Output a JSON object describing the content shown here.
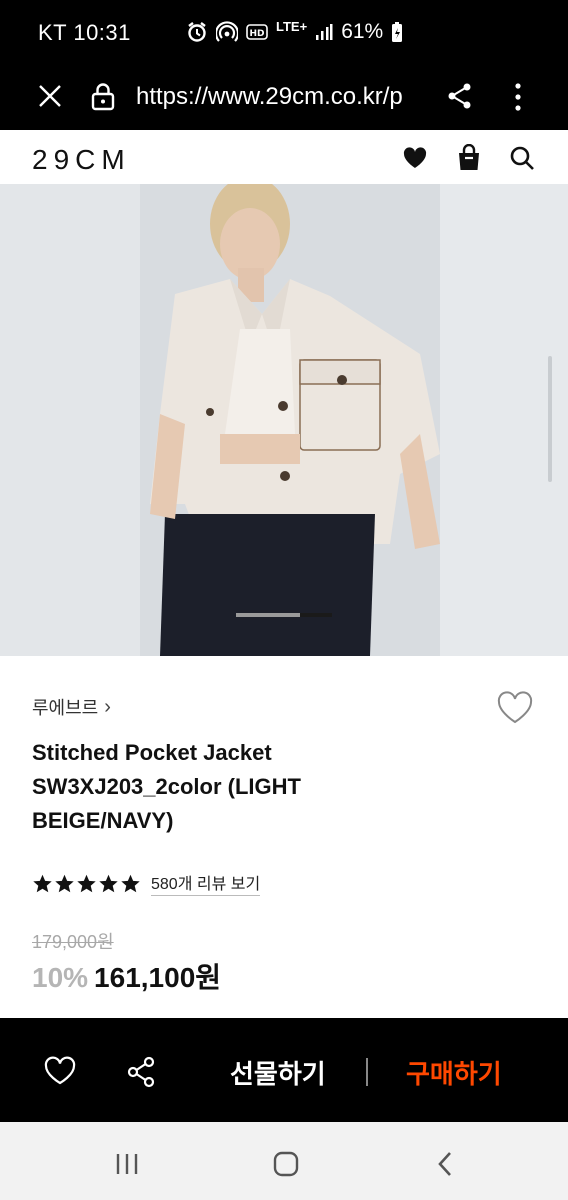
{
  "status_bar": {
    "carrier_time": "KT 10:31",
    "network": "LTE+",
    "battery": "61%",
    "icons": [
      "alarm-icon",
      "hotspot-icon",
      "hd-icon",
      "lte-icon",
      "signal-icon",
      "battery-icon"
    ]
  },
  "browser": {
    "url": "https://www.29cm.co.kr/p",
    "icons": [
      "close-icon",
      "lock-icon",
      "share-icon",
      "more-vertical-icon"
    ]
  },
  "site_header": {
    "logo": "29CM",
    "icons": [
      "heart-icon",
      "shopping-bag-icon",
      "search-icon"
    ]
  },
  "product": {
    "brand": "루에브르",
    "brand_arrow": "›",
    "title": "Stitched Pocket Jacket SW3XJ203_2color (LIGHT BEIGE/NAVY)",
    "rating_stars": 5,
    "review_link": "580개 리뷰 보기",
    "original_price": "179,000원",
    "discount": "10%",
    "sale_price": "161,100원"
  },
  "carousel": {
    "active_fraction": 0.67
  },
  "buy_bar": {
    "gift_label": "선물하기",
    "buy_label": "구매하기",
    "icons": [
      "heart-outline-icon",
      "share-icon"
    ]
  },
  "colors": {
    "accent_buy": "#ff4800",
    "discount_gray": "#b5b5b5",
    "bar_black": "#000000"
  }
}
